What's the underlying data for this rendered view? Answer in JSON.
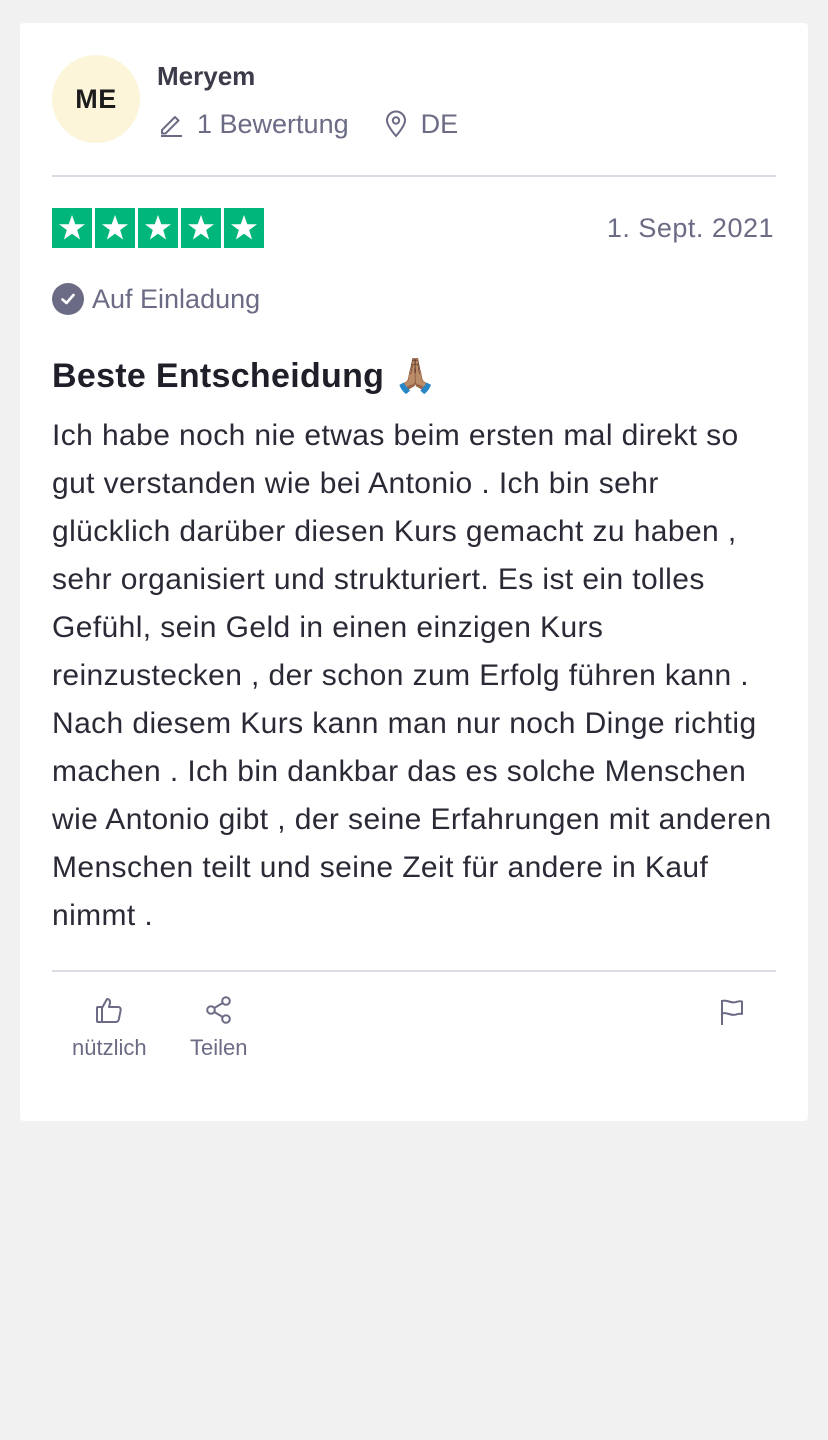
{
  "reviewer": {
    "initials": "ME",
    "name": "Meryem",
    "review_count": "1 Bewertung",
    "country": "DE",
    "avatar_color": "#fcf5d9"
  },
  "review": {
    "rating": 5,
    "rating_max": 5,
    "star_color": "#00b67a",
    "date": "1. Sept. 2021",
    "badge": "Auf Einladung",
    "title": "Beste Entscheidung 🙏🏽",
    "text": "Ich habe noch nie etwas beim ersten mal direkt so gut verstanden wie bei Antonio . Ich bin sehr glücklich darüber diesen Kurs gemacht zu haben , sehr organisiert und strukturiert. Es ist ein tolles Gefühl, sein Geld in einen einzigen Kurs reinzustecken , der schon zum Erfolg führen kann . Nach diesem Kurs kann man nur noch Dinge richtig machen . Ich bin dankbar das es solche Menschen wie Antonio gibt , der seine Erfahrungen mit anderen Menschen teilt und seine Zeit für andere in Kauf nimmt ."
  },
  "actions": {
    "useful_label": "nützlich",
    "share_label": "Teilen"
  },
  "icons": {
    "review_count": "pencil-icon",
    "country": "location-pin-icon",
    "badge": "check-circle-icon",
    "useful": "thumbs-up-icon",
    "share": "share-icon",
    "report": "flag-icon"
  }
}
